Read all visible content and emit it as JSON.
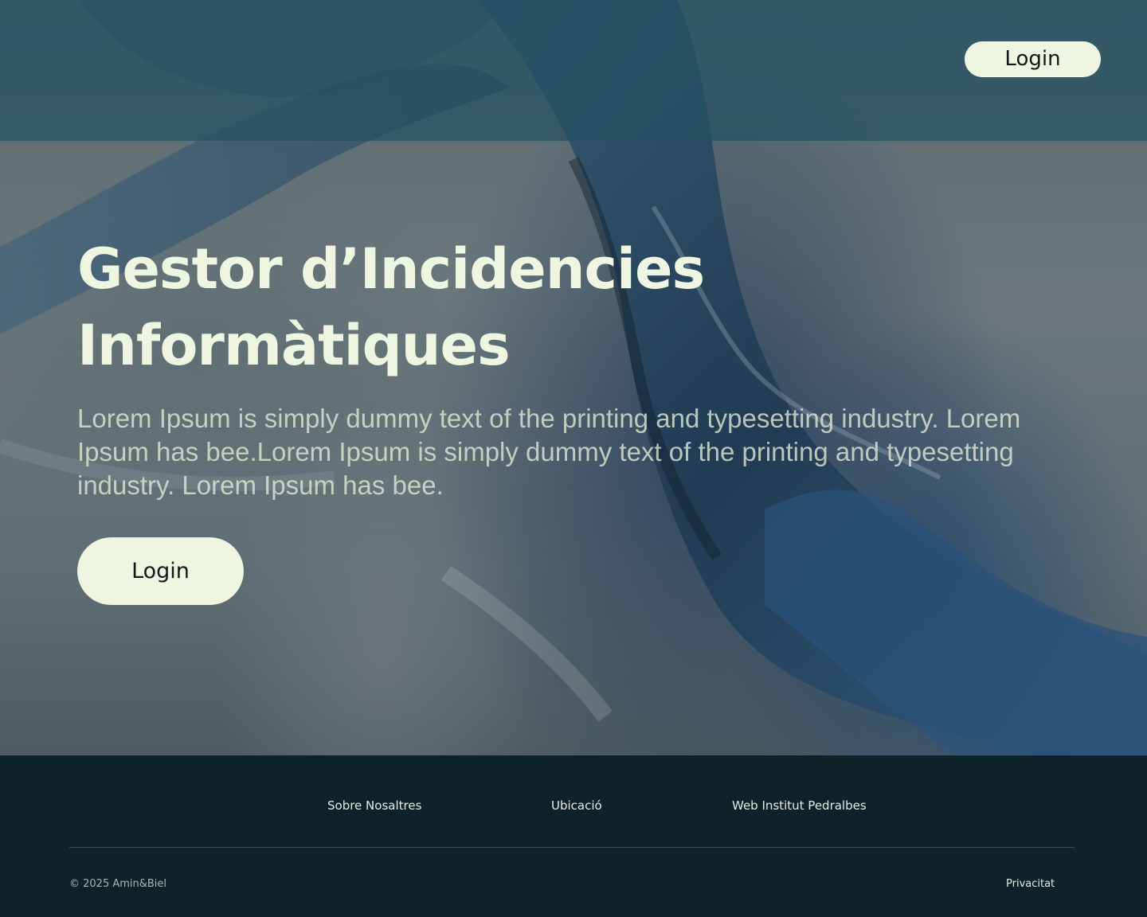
{
  "header": {
    "login_label": "Login"
  },
  "hero": {
    "title_line1": "Gestor d’Incidencies",
    "title_line2": "Informàtiques",
    "description": "Lorem Ipsum is simply dummy text of the printing and typesetting industry. Lorem Ipsum has bee.Lorem Ipsum is simply dummy text of the printing and typesetting industry. Lorem Ipsum has bee.",
    "login_label": "Login"
  },
  "footer": {
    "links": [
      {
        "label": "Sobre Nosaltres"
      },
      {
        "label": "Ubicació"
      },
      {
        "label": "Web Institut Pedralbes"
      }
    ],
    "copyright": "© 2025 Amin&Biel",
    "privacy_label": "Privacitat"
  },
  "colors": {
    "accent": "#eef5e1",
    "footer_bg": "#0e2329",
    "topbar": "#265062"
  }
}
